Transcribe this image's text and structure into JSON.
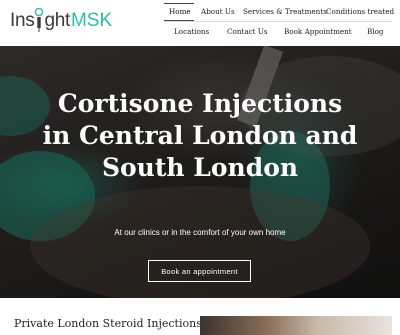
{
  "logo": {
    "text_insight": "Insight",
    "text_msk": "MSK",
    "brand_color": "#2dbf9f"
  },
  "nav": {
    "items": [
      {
        "label": "Home",
        "active": true
      },
      {
        "label": "About Us"
      },
      {
        "label": "Services & Treatments"
      },
      {
        "label": "Conditions treated"
      },
      {
        "label": "Locations"
      },
      {
        "label": "Contact Us"
      },
      {
        "label": "Book Appointment"
      },
      {
        "label": "Blog"
      }
    ]
  },
  "hero": {
    "title_lines": [
      "Cortisone Injections",
      "in Central London and",
      "South London"
    ],
    "subtitle": "At our clinics or in the comfort of your own home",
    "button_label": "Book an appointment"
  },
  "section": {
    "heading": "Private London Steroid Injections"
  }
}
